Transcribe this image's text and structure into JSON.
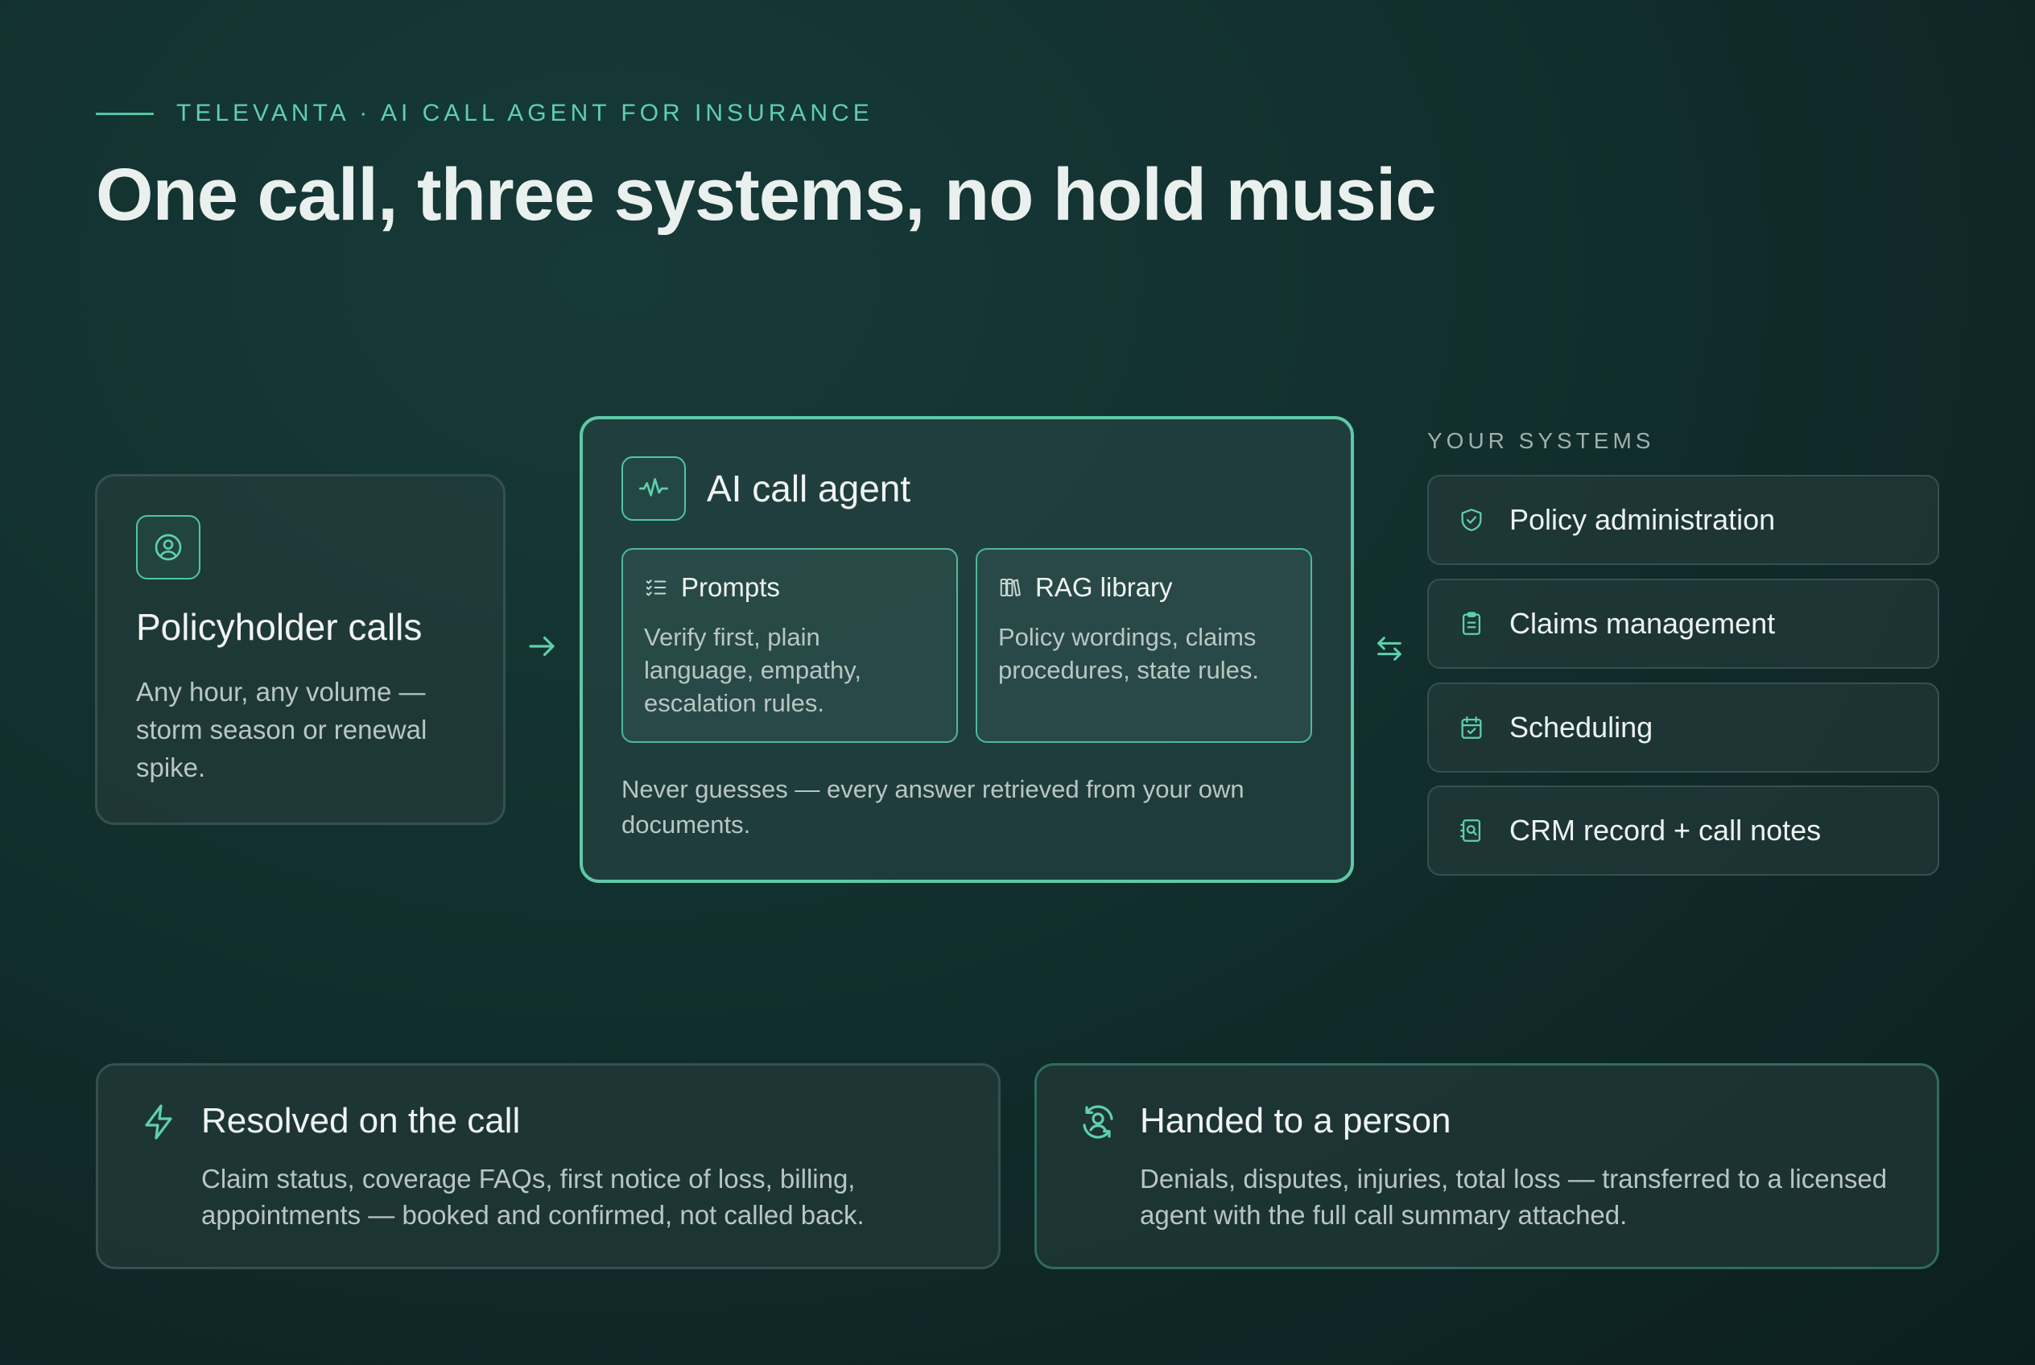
{
  "eyebrow": "TELEVANTA · AI CALL AGENT FOR INSURANCE",
  "headline": "One call, three systems, no hold music",
  "policyholder": {
    "icon": "user-circle-icon",
    "title": "Policyholder calls",
    "body": "Any hour, any volume — storm season or renewal spike."
  },
  "agent": {
    "icon": "waveform-icon",
    "title": "AI call agent",
    "prompts": {
      "icon": "checklist-icon",
      "title": "Prompts",
      "body": "Verify first, plain language, empathy, escalation rules."
    },
    "rag": {
      "icon": "books-icon",
      "title": "RAG library",
      "body": "Policy wordings, claims procedures, state rules."
    },
    "footer": "Never guesses — every answer retrieved from your own documents."
  },
  "systems": {
    "label": "YOUR SYSTEMS",
    "items": [
      {
        "icon": "shield-check-icon",
        "label": "Policy administration"
      },
      {
        "icon": "clipboard-icon",
        "label": "Claims management"
      },
      {
        "icon": "calendar-check-icon",
        "label": "Scheduling"
      },
      {
        "icon": "contact-search-icon",
        "label": "CRM record + call notes"
      }
    ]
  },
  "outcomes": {
    "resolved": {
      "icon": "lightning-icon",
      "title": "Resolved on the call",
      "body": "Claim status, coverage FAQs, first notice of loss, billing, appointments — booked and confirmed, not called back."
    },
    "handed": {
      "icon": "person-transfer-icon",
      "title": "Handed to a person",
      "body": "Denials, disputes, injuries, total loss — transferred to a licensed agent with the full call summary attached."
    }
  },
  "colors": {
    "accent": "#4fc7a3",
    "background": "#12302f",
    "card": "#283e3e",
    "text_muted": "#b9c6c3"
  }
}
